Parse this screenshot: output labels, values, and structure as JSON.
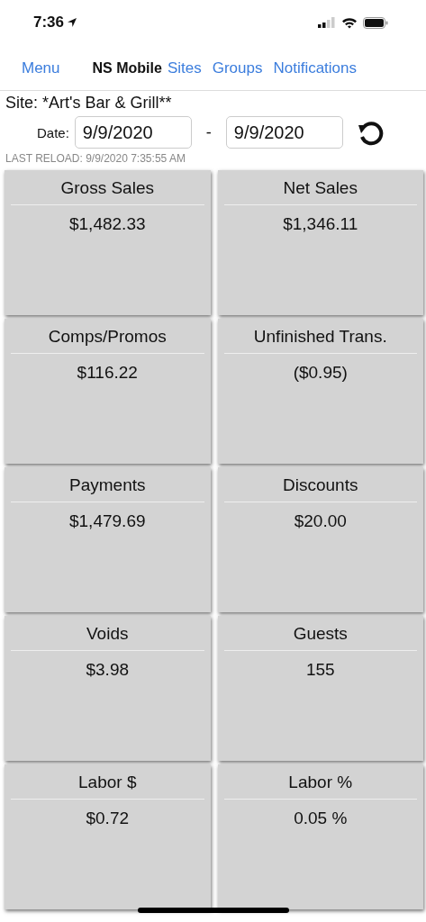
{
  "status_bar": {
    "time": "7:36"
  },
  "nav": {
    "menu": "Menu",
    "title": "NS Mobile",
    "links": [
      "Sites",
      "Groups",
      "Notifications"
    ]
  },
  "site": "Site: *Art's Bar & Grill**",
  "date_filter": {
    "label": "Date:",
    "from": "9/9/2020",
    "separator": "-",
    "to": "9/9/2020"
  },
  "last_reload": "LAST RELOAD: 9/9/2020 7:35:55 AM",
  "tiles": [
    {
      "title": "Gross Sales",
      "value": "$1,482.33"
    },
    {
      "title": "Net Sales",
      "value": "$1,346.11"
    },
    {
      "title": "Comps/Promos",
      "value": "$116.22"
    },
    {
      "title": "Unfinished Trans.",
      "value": "($0.95)"
    },
    {
      "title": "Payments",
      "value": "$1,479.69"
    },
    {
      "title": "Discounts",
      "value": "$20.00"
    },
    {
      "title": "Voids",
      "value": "$3.98"
    },
    {
      "title": "Guests",
      "value": "155"
    },
    {
      "title": "Labor $",
      "value": "$0.72"
    },
    {
      "title": "Labor %",
      "value": "0.05 %"
    }
  ]
}
